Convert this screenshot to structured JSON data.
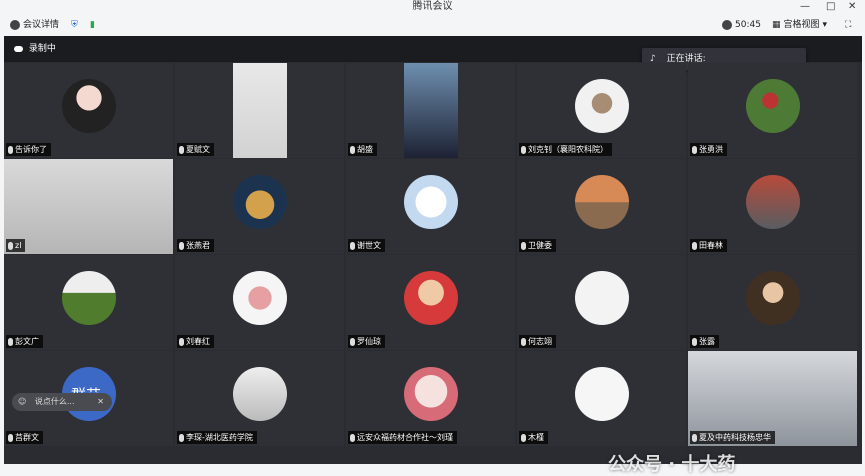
{
  "app": {
    "title": "腾讯会议"
  },
  "toolbar": {
    "details": "会议详情",
    "timer": "50:45",
    "view": "宫格视图"
  },
  "recording": {
    "label": "录制中"
  },
  "speaking": {
    "label": "正在讲话:"
  },
  "participants": [
    {
      "name": "告诉你了"
    },
    {
      "name": "夏赋文"
    },
    {
      "name": "胡盛"
    },
    {
      "name": "刘克钊（襄阳农科院）"
    },
    {
      "name": "张勇洪"
    },
    {
      "name": "zl"
    },
    {
      "name": "张燕君"
    },
    {
      "name": "谢世文"
    },
    {
      "name": "卫健委"
    },
    {
      "name": "田春林"
    },
    {
      "name": "彭文广"
    },
    {
      "name": "刘春红"
    },
    {
      "name": "罗仙琼"
    },
    {
      "name": "何志翊"
    },
    {
      "name": "张露"
    },
    {
      "name": "莒群文"
    },
    {
      "name": "李琛-湖北医药学院"
    },
    {
      "name": "远安众福药材合作社～刘瑾"
    },
    {
      "name": "木槿"
    },
    {
      "name": "夏及中药科技杨忠华"
    }
  ],
  "comment": {
    "placeholder": "说点什么..."
  },
  "watermark": {
    "text": "公众号 · 十大药"
  },
  "avatar_text": {
    "group": "群艾"
  }
}
